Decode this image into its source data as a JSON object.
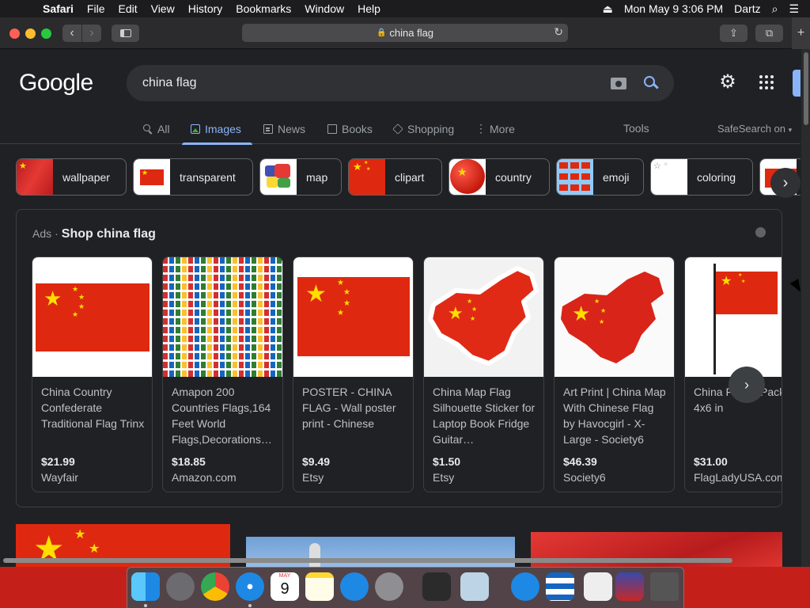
{
  "menubar": {
    "app_name": "Safari",
    "items": [
      "File",
      "Edit",
      "View",
      "History",
      "Bookmarks",
      "Window",
      "Help"
    ],
    "clock": "Mon May 9  3:06 PM",
    "user": "Dartz"
  },
  "browser": {
    "url": "china flag"
  },
  "google": {
    "logo": "Google",
    "query": "china flag",
    "tabs": [
      "All",
      "Images",
      "News",
      "Books",
      "Shopping",
      "More"
    ],
    "active_tab": "Images",
    "tools": "Tools",
    "safesearch": "SafeSearch on"
  },
  "chips": [
    "wallpaper",
    "transparent",
    "map",
    "clipart",
    "country",
    "emoji",
    "coloring"
  ],
  "ads": {
    "label": "Ads",
    "separator": "·",
    "title": "Shop china flag",
    "products": [
      {
        "title": "China Country Confederate Traditional Flag Trinx",
        "price": "$21.99",
        "store": "Wayfair"
      },
      {
        "title": "Amapon 200 Countries Flags,164 Feet World Flags,Decorations…",
        "price": "$18.85",
        "store": "Amazon.com"
      },
      {
        "title": "POSTER - CHINA FLAG - Wall poster print - Chinese",
        "price": "$9.49",
        "store": "Etsy"
      },
      {
        "title": "China Map Flag Silhouette Sticker for Laptop Book Fridge Guitar…",
        "price": "$1.50",
        "store": "Etsy"
      },
      {
        "title": "Art Print | China Map With Chinese Flag by Havocgirl - X-Large - Society6",
        "price": "$46.39",
        "store": "Society6"
      },
      {
        "title": "China Flag 2-Pack 4x6 in",
        "price": "$31.00",
        "store": "FlagLadyUSA.com"
      }
    ]
  },
  "dock": {
    "calendar_month": "MAY",
    "calendar_day": "9"
  },
  "colors": {
    "flag_red": "#de2910",
    "flag_yellow": "#ffde00",
    "accent_blue": "#8ab4f8",
    "page_bg": "#202124"
  },
  "icons": [
    "apple-icon",
    "wifi-icon",
    "search-icon",
    "control-center-icon",
    "camera-icon",
    "gear-icon",
    "apps-grid-icon",
    "chevron-right-icon",
    "lock-icon",
    "reload-icon",
    "share-icon",
    "tabs-icon"
  ]
}
